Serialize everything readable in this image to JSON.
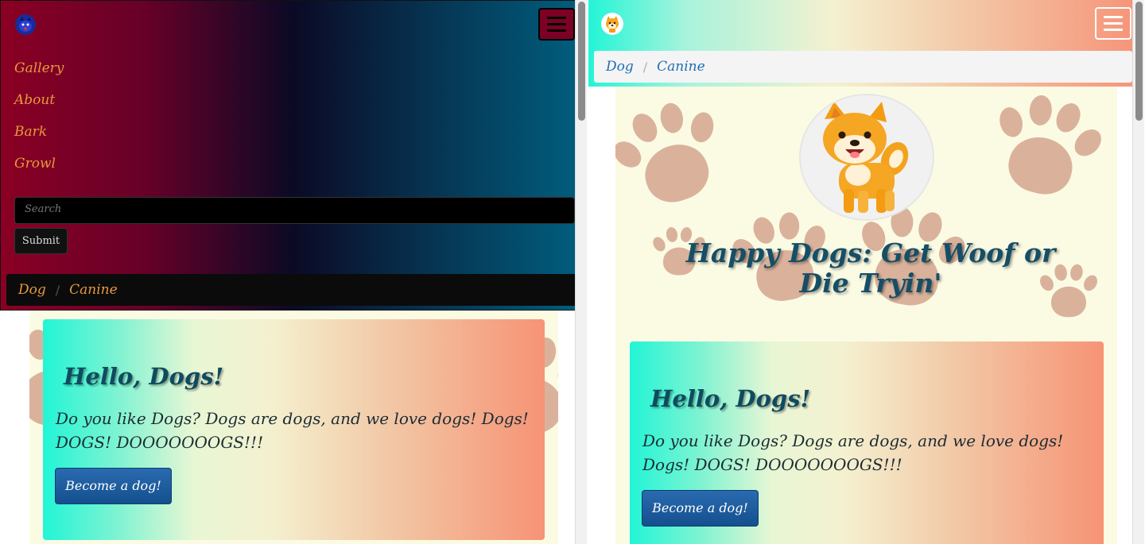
{
  "colors": {
    "nav_dark_start": "#8a0024",
    "nav_dark_mid": "#0b0a25",
    "nav_dark_end": "#00607f",
    "nav_link": "#e8993c",
    "jumbo_start": "#22f5d6",
    "jumbo_end": "#f69375",
    "button": "#1f5fa0",
    "breadcrumb_link_light": "#1f6eb5",
    "page_bg": "#fbfbe3"
  },
  "left": {
    "brand_icon": "dog-logo-icon",
    "toggler_icon": "hamburger-menu-icon",
    "nav_items": [
      {
        "label": "Gallery"
      },
      {
        "label": "About"
      },
      {
        "label": "Bark"
      },
      {
        "label": "Growl"
      }
    ],
    "search": {
      "placeholder": "Search",
      "value": ""
    },
    "submit_label": "Submit",
    "breadcrumb": [
      "Dog",
      "Canine"
    ],
    "breadcrumb_separator": "/",
    "jumbotron": {
      "title": "Hello, Dogs!",
      "text": "Do you like Dogs? Dogs are dogs, and we love dogs! Dogs! DOGS! DOOOOOOOGS!!!",
      "button_label": "Become a dog!"
    }
  },
  "right": {
    "brand_icon": "shiba-logo-icon",
    "toggler_icon": "hamburger-menu-icon",
    "breadcrumb": [
      "Dog",
      "Canine"
    ],
    "breadcrumb_separator": "/",
    "hero_image": "shiba-dog-image",
    "hero_title": "Happy Dogs: Get Woof or Die Tryin'",
    "jumbotron": {
      "title": "Hello, Dogs!",
      "text": "Do you like Dogs? Dogs are dogs, and we love dogs! Dogs! DOGS! DOOOOOOOGS!!!",
      "button_label": "Become a dog!"
    }
  }
}
